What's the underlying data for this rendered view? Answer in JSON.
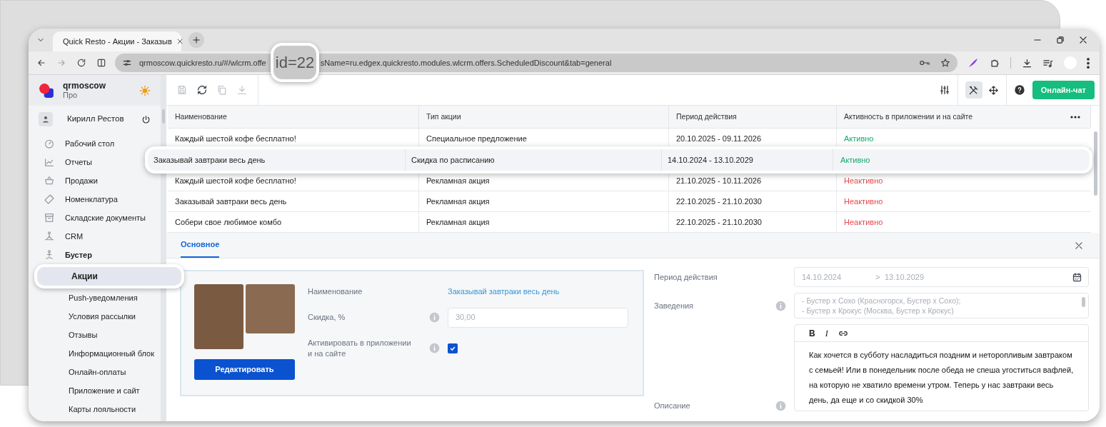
{
  "browser": {
    "tab_title": "Quick Resto - Акции - Заказыв",
    "url_start": "qrmoscow.quickresto.ru/#/wlcrm.offe",
    "url_end": "sName=ru.edgex.quickresto.modules.wlcrm.offers.ScheduledDiscount&tab=general",
    "url_zoom": "id=22"
  },
  "account": {
    "name": "qrmoscow",
    "plan": "Про"
  },
  "user": {
    "name": "Кирилл Рестов"
  },
  "sidebar": {
    "items": [
      {
        "label": "Рабочий стол",
        "selected": false,
        "expanded": false
      },
      {
        "label": "Отчеты",
        "selected": false,
        "expanded": false
      },
      {
        "label": "Продажи",
        "selected": false,
        "expanded": false
      },
      {
        "label": "Номенклатура",
        "selected": false,
        "expanded": false
      },
      {
        "label": "Складские документы",
        "selected": false,
        "expanded": false
      },
      {
        "label": "CRM",
        "selected": false,
        "expanded": false
      },
      {
        "label": "Бустер",
        "selected": false,
        "expanded": true,
        "children": [
          {
            "label": "Акции",
            "selected": true
          },
          {
            "label": "Push-уведомления",
            "selected": false
          },
          {
            "label": "Условия рассылки",
            "selected": false
          },
          {
            "label": "Отзывы",
            "selected": false
          },
          {
            "label": "Информационный блок",
            "selected": false
          },
          {
            "label": "Онлайн-оплаты",
            "selected": false
          },
          {
            "label": "Приложение и сайт",
            "selected": false
          },
          {
            "label": "Карты лояльности",
            "selected": false
          }
        ]
      }
    ]
  },
  "toolbar": {
    "actions": [
      {
        "disabled": true
      },
      {
        "disabled": false
      },
      {
        "disabled": true
      },
      {
        "disabled": true
      }
    ],
    "tools_pressed": true,
    "chat_button": "Онлайн-чат"
  },
  "table": {
    "columns": [
      "Наименование",
      "Тип акции",
      "Период действия",
      "Активность в приложении и на сайте"
    ],
    "rows": [
      {
        "name": "Каждый шестой кофе бесплатно!",
        "type": "Специальное предложение",
        "period": "20.10.2025 - 09.11.2026",
        "activity": "Активно",
        "active": true,
        "highlighted": false
      },
      {
        "name": "Заказывай завтраки весь день",
        "type": "Скидка по расписанию",
        "period": "14.10.2024 - 13.10.2029",
        "activity": "Активно",
        "active": true,
        "highlighted": true
      },
      {
        "name": "Каждый шестой кофе бесплатно!",
        "type": "Рекламная акция",
        "period": "21.10.2025 - 10.11.2026",
        "activity": "Неактивно",
        "active": false,
        "highlighted": false
      },
      {
        "name": "Заказывай завтраки весь день",
        "type": "Рекламная акция",
        "period": "22.10.2025 - 21.10.2030",
        "activity": "Неактивно",
        "active": false,
        "highlighted": false
      },
      {
        "name": "Собери свое любимое комбо",
        "type": "Рекламная акция",
        "period": "22.10.2025 - 21.10.2030",
        "activity": "Неактивно",
        "active": false,
        "highlighted": false
      }
    ]
  },
  "detail": {
    "tabs": [
      {
        "label": "Основное",
        "selected": true
      }
    ],
    "name": {
      "label": "Наименование",
      "value": "Заказывай завтраки весь день"
    },
    "discount": {
      "label": "Скидка, %",
      "value": "30,00"
    },
    "activate": {
      "label": "Активировать в приложении и на сайте",
      "checked": true
    },
    "edit_button": "Редактировать",
    "period": {
      "label": "Период действия",
      "from": "14.10.2024",
      "separator": ">",
      "to": "13.10.2029"
    },
    "venues": {
      "label": "Заведения",
      "lines": [
        "- Бустер х Сохо (Красногорск, Бустер х Сохо);",
        "- Бустер х Крокус (Москва, Бустер х Крокус)"
      ]
    },
    "editor": {
      "buttons": [
        "B",
        "I"
      ],
      "text": "Как хочется в субботу насладиться поздним и неторопливым завтраком с семьей! Или в понедельник после обеда не спеша угоститься вафлей, на которую не хватило времени утром. Теперь у нас завтраки весь день, да еще и со скидкой 30%"
    },
    "description": {
      "label": "Описание"
    }
  }
}
